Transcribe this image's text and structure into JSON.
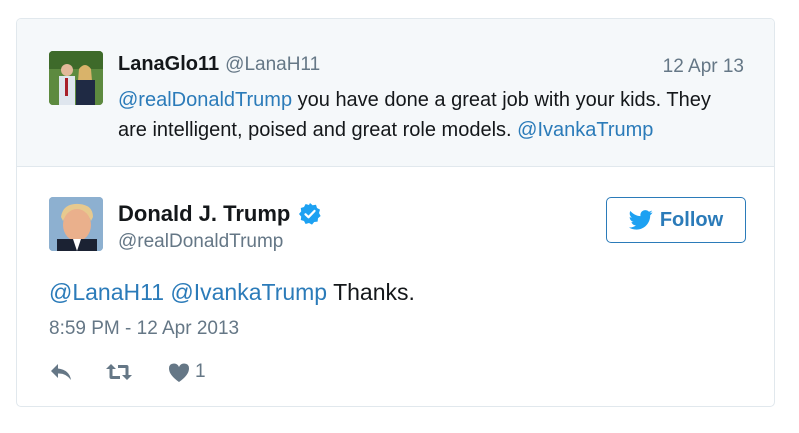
{
  "quoted": {
    "name": "LanaGlo11",
    "handle": "@LanaH11",
    "date": "12 Apr 13",
    "mention_start": "@realDonaldTrump",
    "text_middle": " you have done a great job with your kids. They are intelligent, poised and great role models. ",
    "mention_end": "@IvankaTrump"
  },
  "author": {
    "name": "Donald J. Trump",
    "handle": "@realDonaldTrump",
    "verified_icon": "verified-badge-icon"
  },
  "follow": {
    "label": "Follow",
    "icon": "twitter-bird-icon"
  },
  "tweet": {
    "mention1": "@LanaH11",
    "mention2": "@IvankaTrump",
    "body": " Thanks."
  },
  "timestamp": "8:59 PM - 12 Apr 2013",
  "actions": {
    "reply_icon": "reply-icon",
    "retweet_icon": "retweet-icon",
    "like_icon": "heart-icon",
    "like_count": "1"
  },
  "colors": {
    "link": "#2b7bb9",
    "muted": "#657786",
    "text": "#14171a",
    "quoted_bg": "#f5f8fa",
    "border": "#e1e8ed",
    "verified": "#1da1f2"
  }
}
